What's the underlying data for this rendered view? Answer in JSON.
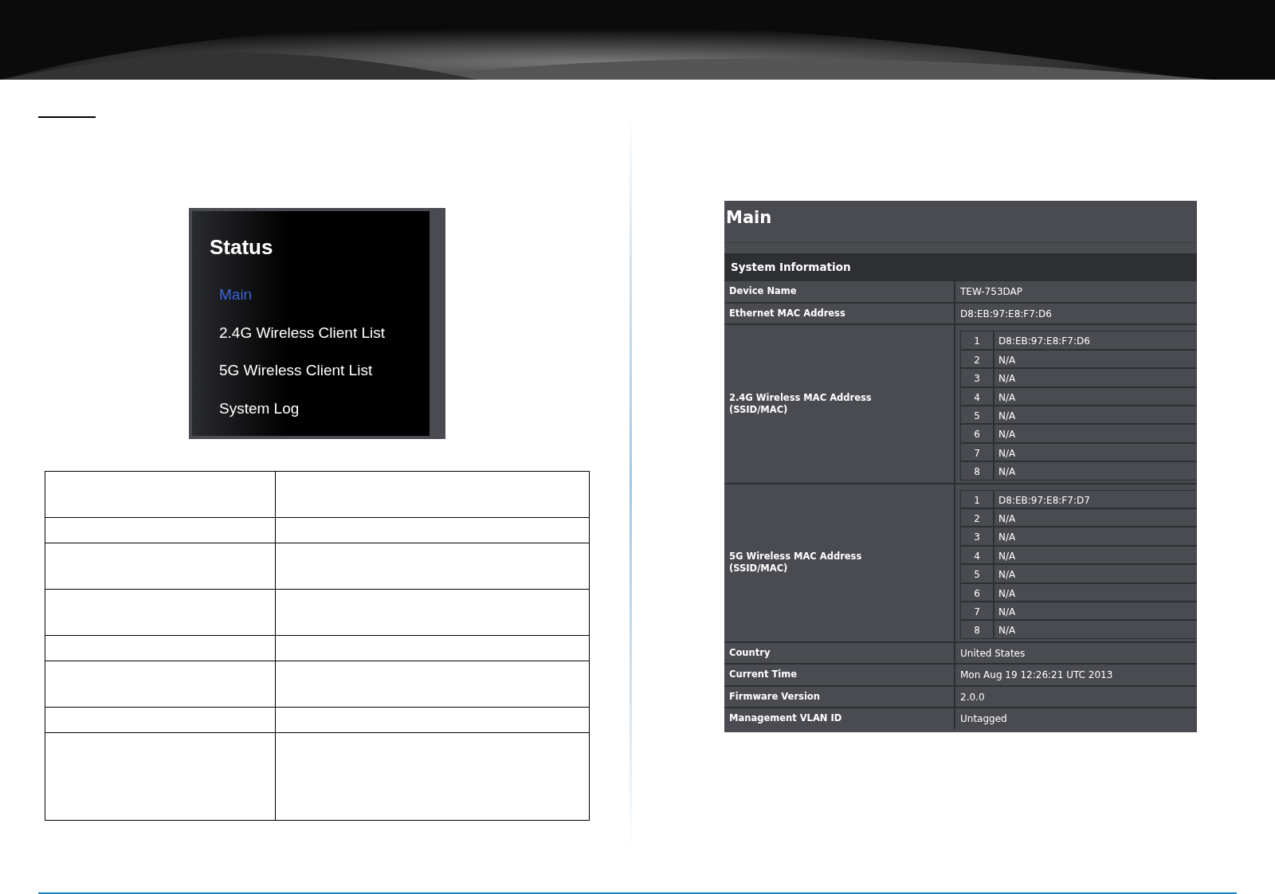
{
  "sidebar": {
    "title": "Status",
    "items": [
      {
        "label": "Main",
        "selected": true
      },
      {
        "label": "2.4G Wireless Client List",
        "selected": false
      },
      {
        "label": "5G Wireless Client List",
        "selected": false
      },
      {
        "label": "System Log",
        "selected": false
      }
    ]
  },
  "panel": {
    "title": "Main",
    "section": "System Information",
    "rows": [
      {
        "kind": "text",
        "label": "Device Name",
        "value": "TEW-753DAP"
      },
      {
        "kind": "text",
        "label": "Ethernet MAC Address",
        "value": "D8:EB:97:E8:F7:D6"
      },
      {
        "kind": "list",
        "label": "2.4G Wireless MAC Address\n(SSID/MAC)",
        "entries": [
          {
            "index": "1",
            "value": "D8:EB:97:E8:F7:D6"
          },
          {
            "index": "2",
            "value": "N/A"
          },
          {
            "index": "3",
            "value": "N/A"
          },
          {
            "index": "4",
            "value": "N/A"
          },
          {
            "index": "5",
            "value": "N/A"
          },
          {
            "index": "6",
            "value": "N/A"
          },
          {
            "index": "7",
            "value": "N/A"
          },
          {
            "index": "8",
            "value": "N/A"
          }
        ]
      },
      {
        "kind": "list",
        "label": "5G Wireless MAC Address\n(SSID/MAC)",
        "entries": [
          {
            "index": "1",
            "value": "D8:EB:97:E8:F7:D7"
          },
          {
            "index": "2",
            "value": "N/A"
          },
          {
            "index": "3",
            "value": "N/A"
          },
          {
            "index": "4",
            "value": "N/A"
          },
          {
            "index": "5",
            "value": "N/A"
          },
          {
            "index": "6",
            "value": "N/A"
          },
          {
            "index": "7",
            "value": "N/A"
          },
          {
            "index": "8",
            "value": "N/A"
          }
        ]
      },
      {
        "kind": "text",
        "label": "Country",
        "value": "United States"
      },
      {
        "kind": "text",
        "label": "Current Time",
        "value": "Mon Aug 19 12:26:21 UTC 2013"
      },
      {
        "kind": "text",
        "label": "Firmware Version",
        "value": "2.0.0"
      },
      {
        "kind": "text",
        "label": "Management VLAN ID",
        "value": "Untagged"
      }
    ]
  }
}
